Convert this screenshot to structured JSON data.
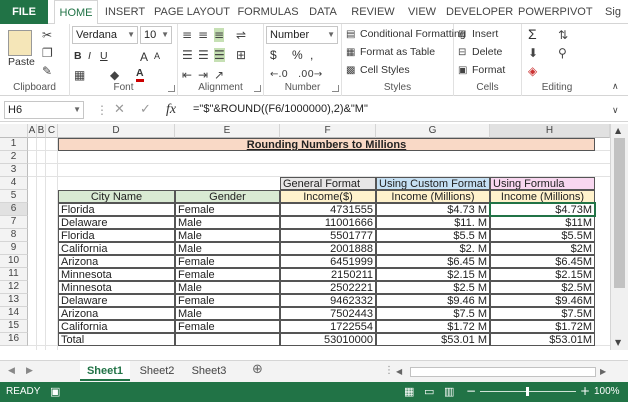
{
  "tabs": {
    "file": "FILE",
    "home": "HOME",
    "insert": "INSERT",
    "page_layout": "PAGE LAYOUT",
    "formulas": "FORMULAS",
    "data": "DATA",
    "review": "REVIEW",
    "view": "VIEW",
    "developer": "DEVELOPER",
    "powerpivot": "POWERPIVOT",
    "sign": "Sig"
  },
  "ribbon": {
    "clipboard": {
      "label": "Clipboard",
      "paste": "Paste"
    },
    "font": {
      "label": "Font",
      "name": "Verdana",
      "size": "10",
      "bold": "B",
      "italic": "I",
      "underline": "U",
      "grow": "A",
      "shrink": "A",
      "font_color": "A"
    },
    "alignment": {
      "label": "Alignment"
    },
    "number": {
      "label": "Number",
      "format": "Number",
      "currency": "$",
      "percent": "%",
      "comma": ","
    },
    "styles": {
      "label": "Styles",
      "conditional": "Conditional Formatting",
      "format_table": "Format as Table",
      "cell_styles": "Cell Styles"
    },
    "cells": {
      "label": "Cells",
      "insert": "Insert",
      "delete": "Delete",
      "format": "Format"
    },
    "editing": {
      "label": "Editing",
      "sigma": "Σ"
    }
  },
  "formula_bar": {
    "name_box": "H6",
    "fx": "fx",
    "formula": "=\"$\"&ROUND((F6/1000000),2)&\"M\""
  },
  "columns": [
    "A",
    "B",
    "C",
    "D",
    "E",
    "F",
    "G",
    "H"
  ],
  "rows": [
    "1",
    "2",
    "3",
    "4",
    "5",
    "6",
    "7",
    "8",
    "9",
    "10",
    "11",
    "12",
    "13",
    "14",
    "15",
    "16"
  ],
  "sheet": {
    "title": "Rounding Numbers to Millions",
    "group_headers": {
      "f": "General Format",
      "g": "Using Custom Format",
      "h": "Using Formula"
    },
    "headers": {
      "d": "City Name",
      "e": "Gender",
      "f": "Income($)",
      "g": "Income (Millions)",
      "h": "Income (Millions)"
    },
    "data": [
      [
        "Florida",
        "Female",
        "4731555",
        "$4.73 M",
        "$4.73M"
      ],
      [
        "Delaware",
        "Male",
        "11001666",
        "$11. M",
        "$11M"
      ],
      [
        "Florida",
        "Male",
        "5501777",
        "$5.5 M",
        "$5.5M"
      ],
      [
        "California",
        "Male",
        "2001888",
        "$2. M",
        "$2M"
      ],
      [
        "Arizona",
        "Female",
        "6451999",
        "$6.45 M",
        "$6.45M"
      ],
      [
        "Minnesota",
        "Female",
        "2150211",
        "$2.15 M",
        "$2.15M"
      ],
      [
        "Minnesota",
        "Male",
        "2502221",
        "$2.5 M",
        "$2.5M"
      ],
      [
        "Delaware",
        "Female",
        "9462332",
        "$9.46 M",
        "$9.46M"
      ],
      [
        "Arizona",
        "Male",
        "7502443",
        "$7.5 M",
        "$7.5M"
      ],
      [
        "California",
        "Female",
        "1722554",
        "$1.72 M",
        "$1.72M"
      ]
    ],
    "total": [
      "Total",
      "",
      "53010000",
      "$53.01 M",
      "$53.01M"
    ]
  },
  "sheet_tabs": [
    "Sheet1",
    "Sheet2",
    "Sheet3"
  ],
  "status": {
    "ready": "READY",
    "zoom": "100%"
  },
  "colors": {
    "excel_green": "#217346",
    "tan": "#f9d9c6",
    "green_hdr": "#d9ead3",
    "yellow": "#fff2cc",
    "blue": "#c6e0f3",
    "pink": "#f8d7f0",
    "gray": "#e7e6e6"
  }
}
